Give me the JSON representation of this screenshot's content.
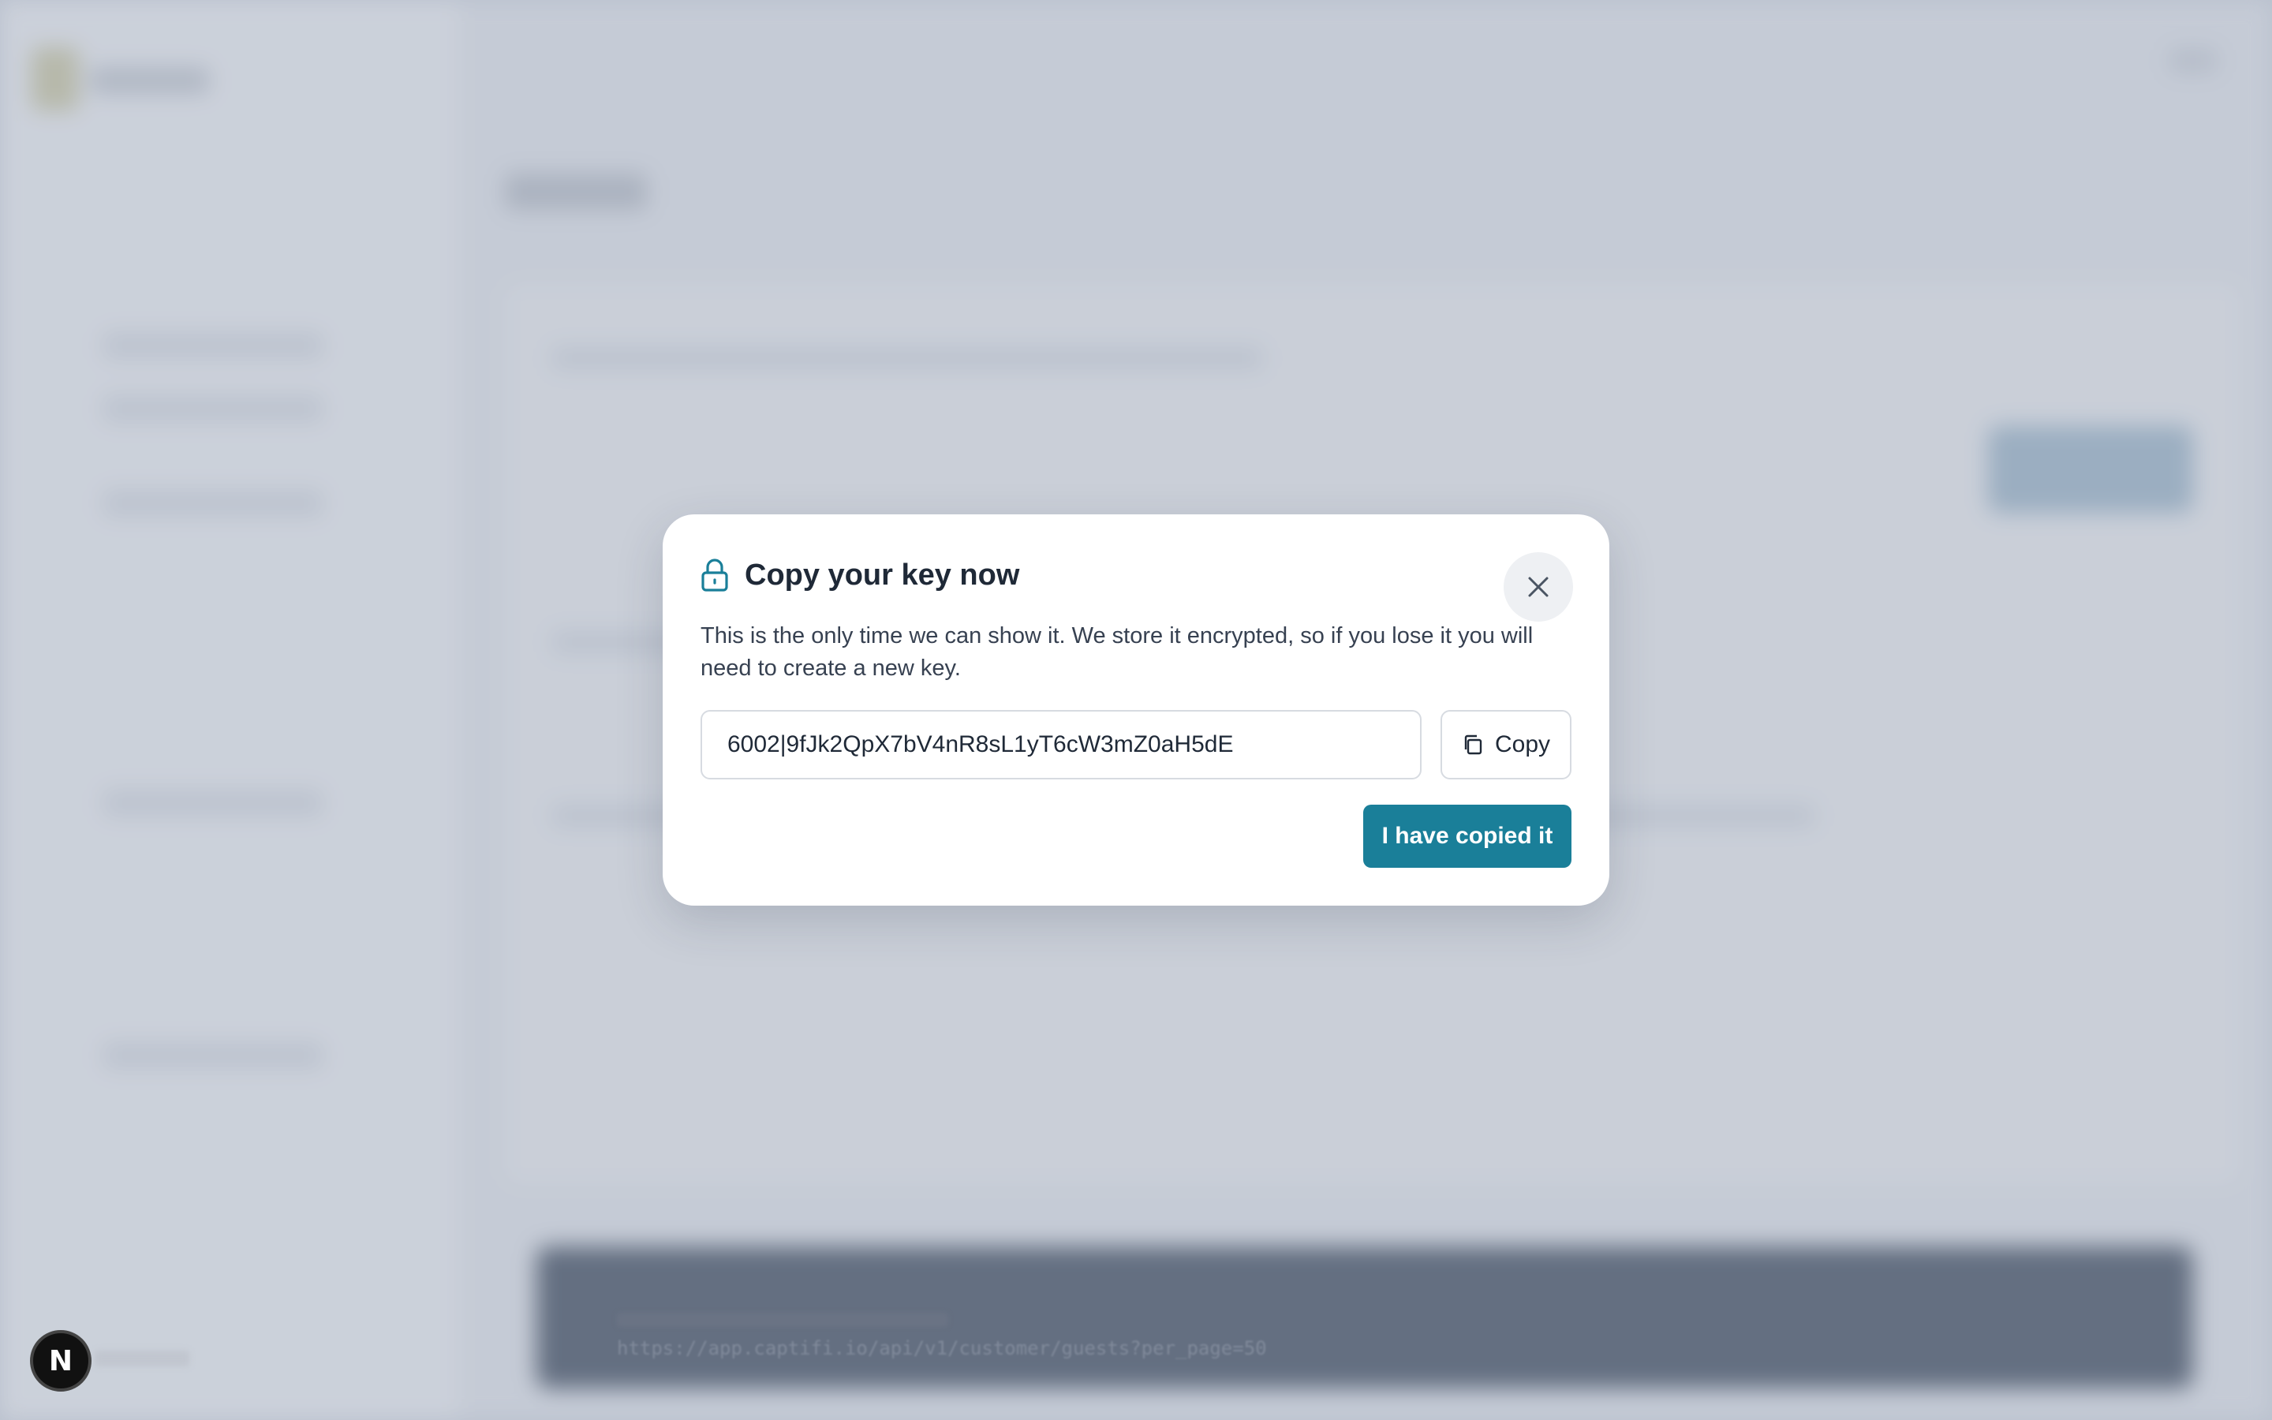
{
  "background": {
    "code_line": "https://app.captifi.io/api/v1/customer/guests?per_page=50",
    "badge_letter": "N"
  },
  "modal": {
    "title": "Copy your key now",
    "description": "This is the only time we can show it. We store it encrypted, so if you lose it you will need to create a new key.",
    "key_value": "6002|9fJk2QpX7bV4nR8sL1yT6cW3mZ0aH5dE",
    "copy_label": "Copy",
    "confirm_label": "I have copied it",
    "icons": {
      "title_icon": "lock-icon",
      "close_icon": "close-icon",
      "copy_icon": "copy-icon"
    },
    "colors": {
      "accent": "#1a7f99",
      "title_text": "#1f2937",
      "body_text": "#374151"
    }
  }
}
